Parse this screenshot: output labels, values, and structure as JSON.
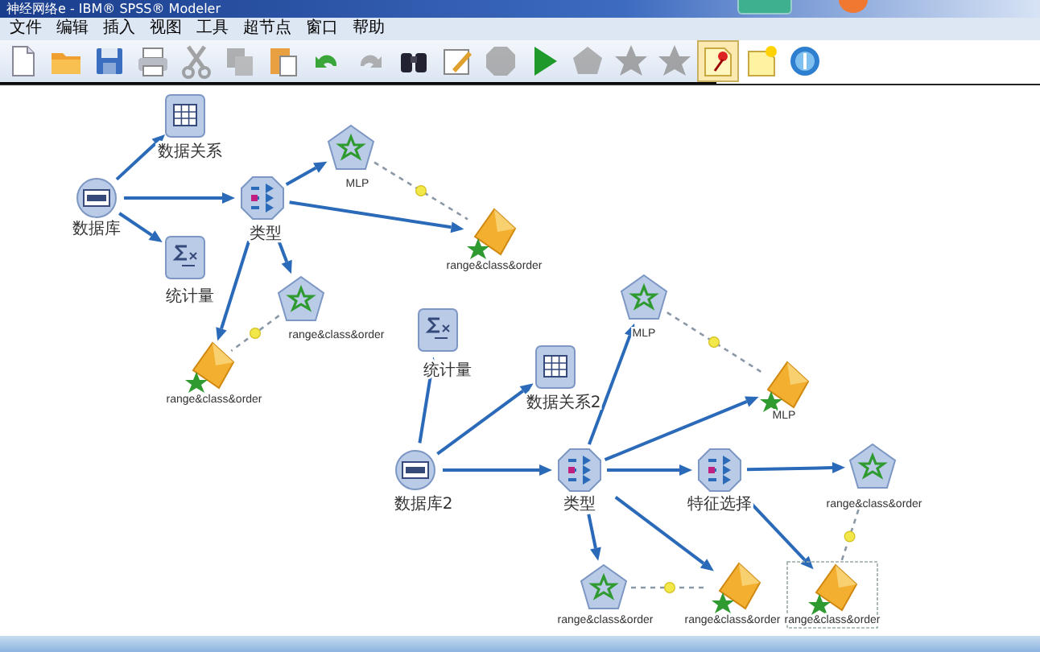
{
  "window": {
    "title": "神经网络e - IBM® SPSS® Modeler"
  },
  "menu": [
    "文件",
    "编辑",
    "插入",
    "视图",
    "工具",
    "超节点",
    "窗口",
    "帮助"
  ],
  "toolbar": [
    {
      "disabled": false,
      "selected": false
    },
    {
      "disabled": false,
      "selected": false
    },
    {
      "disabled": false,
      "selected": false
    },
    {
      "disabled": false,
      "selected": false
    },
    {
      "disabled": true,
      "selected": false
    },
    {
      "disabled": true,
      "selected": false
    },
    {
      "disabled": false,
      "selected": false
    },
    {
      "disabled": false,
      "selected": false
    },
    {
      "disabled": true,
      "selected": false
    },
    {
      "disabled": false,
      "selected": false
    },
    {
      "disabled": false,
      "selected": false
    },
    {
      "disabled": true,
      "selected": false
    },
    {
      "disabled": false,
      "selected": false
    },
    {
      "disabled": true,
      "selected": false
    },
    {
      "disabled": true,
      "selected": false
    },
    {
      "disabled": true,
      "selected": false
    },
    {
      "disabled": false,
      "selected": true
    },
    {
      "disabled": false,
      "selected": false
    },
    {
      "disabled": false,
      "selected": false
    }
  ],
  "nodes": [
    {
      "kind": "source",
      "label": "数据库",
      "selected": false
    },
    {
      "kind": "table",
      "label": "数据关系",
      "selected": false
    },
    {
      "kind": "stats",
      "label": "统计量",
      "selected": false
    },
    {
      "kind": "type",
      "label": "类型",
      "selected": false
    },
    {
      "kind": "model",
      "label": "MLP",
      "selected": false
    },
    {
      "kind": "nugget",
      "label": "range&class&order",
      "selected": false
    },
    {
      "kind": "model",
      "label": "range&class&order",
      "selected": false
    },
    {
      "kind": "nugget",
      "label": "range&class&order",
      "selected": false
    },
    {
      "kind": "stats",
      "label": "统计量",
      "selected": false
    },
    {
      "kind": "table",
      "label": "数据关系2",
      "selected": false
    },
    {
      "kind": "source",
      "label": "数据库2",
      "selected": false
    },
    {
      "kind": "type",
      "label": "类型",
      "selected": false
    },
    {
      "kind": "model",
      "label": "MLP",
      "selected": false
    },
    {
      "kind": "nugget",
      "label": "MLP",
      "selected": false
    },
    {
      "kind": "type",
      "label": "特征选择",
      "selected": false
    },
    {
      "kind": "model",
      "label": "range&class&order",
      "selected": false
    },
    {
      "kind": "model",
      "label": "range&class&order",
      "selected": false
    },
    {
      "kind": "nugget",
      "label": "range&class&order",
      "selected": false
    },
    {
      "kind": "nugget",
      "label": "range&class&order",
      "selected": true
    }
  ]
}
